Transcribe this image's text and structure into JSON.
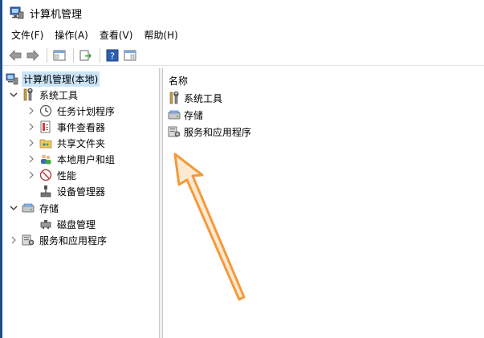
{
  "window": {
    "title": "计算机管理"
  },
  "menu": {
    "items": [
      "文件(F)",
      "操作(A)",
      "查看(V)",
      "帮助(H)"
    ]
  },
  "toolbar": {
    "buttons": [
      "back-arrow-icon",
      "forward-arrow-icon",
      "console-tree-icon",
      "export-list-icon",
      "help-icon",
      "properties-icon"
    ]
  },
  "tree": {
    "root": "计算机管理(本地)",
    "system_tools": "系统工具",
    "task_scheduler": "任务计划程序",
    "event_viewer": "事件查看器",
    "shared_folders": "共享文件夹",
    "local_users": "本地用户和组",
    "performance": "性能",
    "device_manager": "设备管理器",
    "storage": "存储",
    "disk_management": "磁盘管理",
    "services_apps": "服务和应用程序"
  },
  "list": {
    "header": "名称",
    "items": [
      "系统工具",
      "存储",
      "服务和应用程序"
    ]
  },
  "colors": {
    "accent": "#1f4e8c",
    "selection": "#cce4f7",
    "arrow": "#f39a3a"
  }
}
